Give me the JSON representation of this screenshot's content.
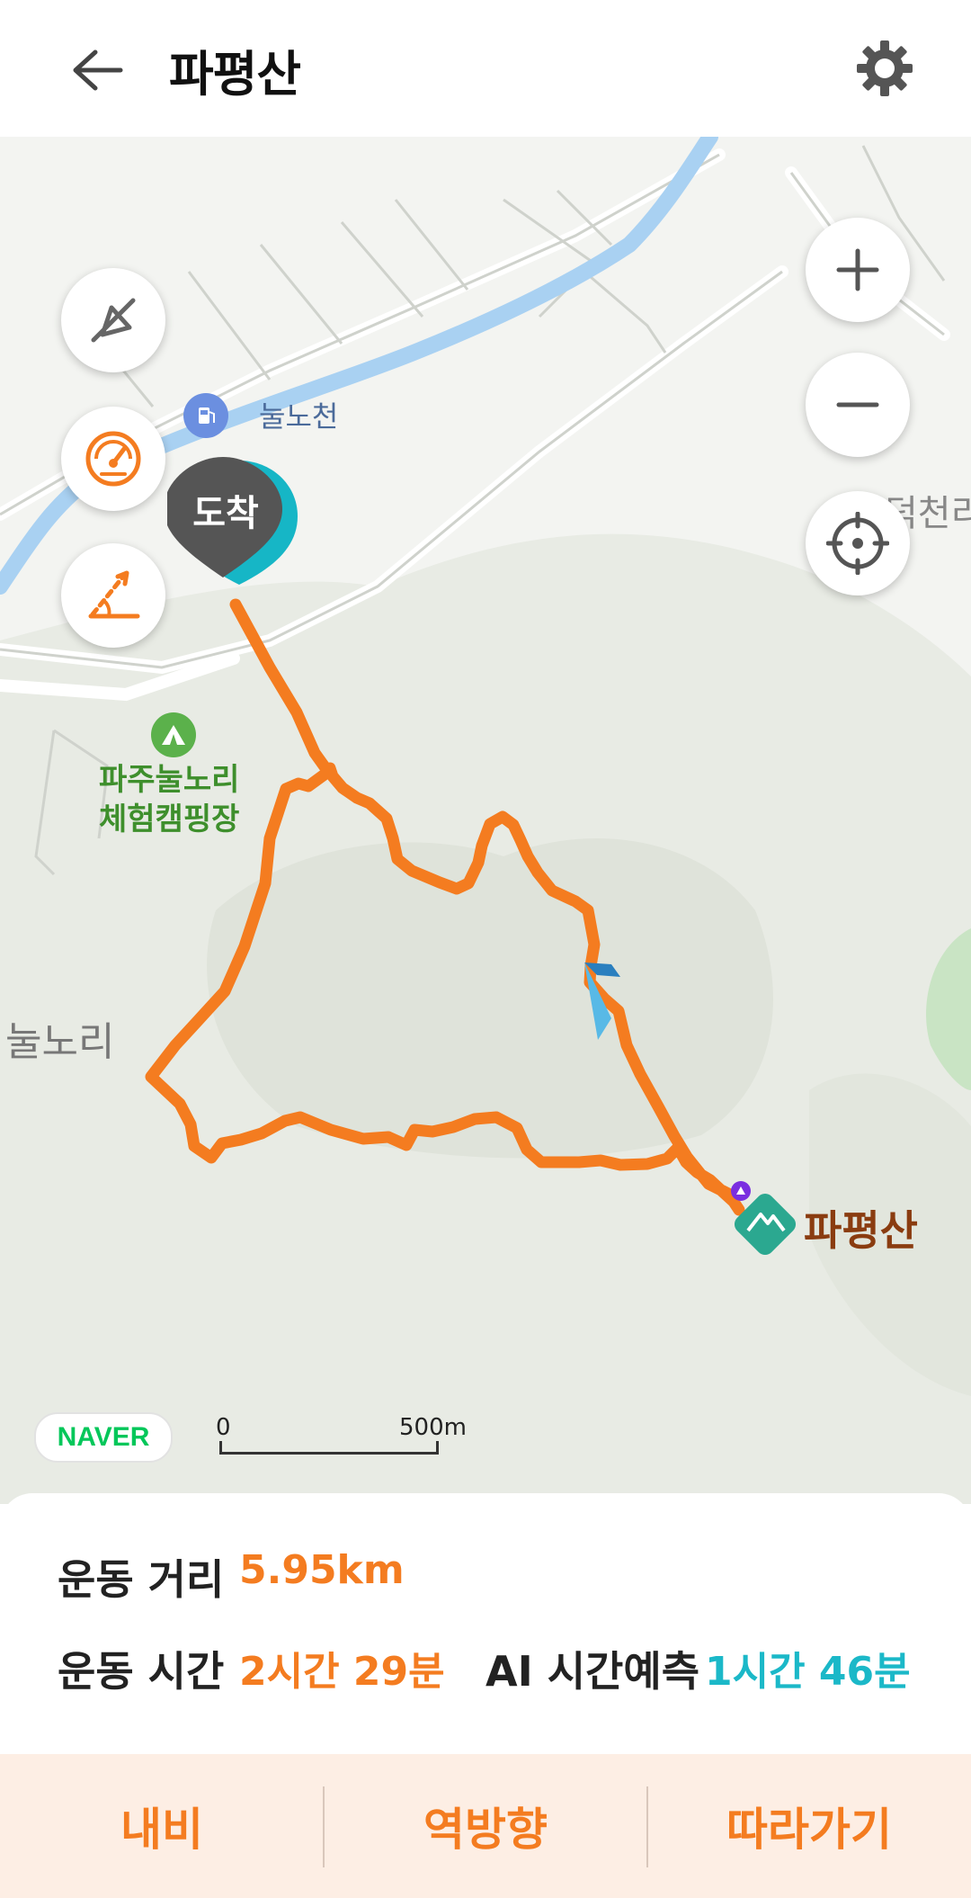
{
  "header": {
    "title": "파평산"
  },
  "map": {
    "labels": {
      "stream": "눌노천",
      "village": "눌노리",
      "camp_line1": "파주눌노리",
      "camp_line2": "체험캠핑장",
      "east": "덕천리",
      "mountain": "파평산"
    },
    "arrival_marker": "도착",
    "naver_logo": "NAVER",
    "scale": {
      "start": "0",
      "end": "500m"
    }
  },
  "stats": {
    "distance_label": "운동 거리",
    "distance_value": "5.95km",
    "time_label": "운동 시간",
    "time_value": "2시간 29분",
    "ai_label": "AI 시간예측",
    "ai_value": "1시간 46분"
  },
  "actions": {
    "navi": "내비",
    "reverse": "역방향",
    "follow": "따라가기"
  },
  "colors": {
    "accent": "#f47c20",
    "teal": "#1bb8c8",
    "route": "#f47c20"
  },
  "icons": [
    "arrow-left-icon",
    "gear-icon",
    "compass-off-icon",
    "speedometer-icon",
    "slope-icon",
    "plus-icon",
    "minus-icon",
    "crosshair-icon",
    "gas-station-icon",
    "camping-icon",
    "mountain-icon"
  ]
}
